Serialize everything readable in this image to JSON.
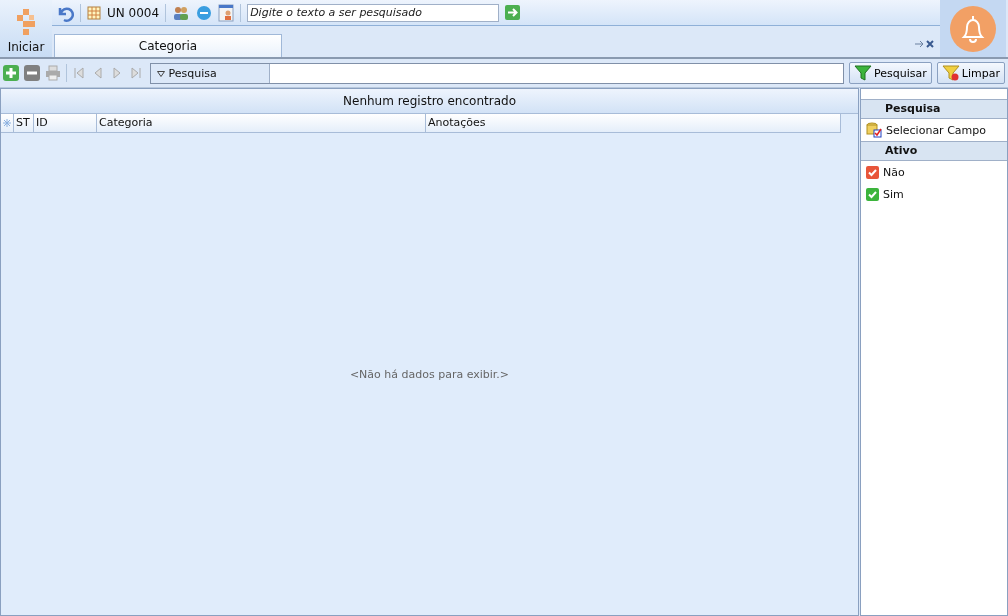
{
  "start_label": "Iniciar",
  "toolbar": {
    "unit": "UN 0004",
    "search": {
      "placeholder": "Digite o texto a ser pesquisado"
    }
  },
  "tabs": [
    {
      "label": "Categoria",
      "selected": true
    }
  ],
  "grid_toolbar": {
    "filter_label": "Pesquisa",
    "buttons": [
      "Pesquisar",
      "Limpar"
    ]
  },
  "grid": {
    "status": "Nenhum registro encontrado",
    "columns": [
      "ST",
      "ID",
      "Categoria",
      "Anotações"
    ],
    "empty_text": "<Não há dados para exibir.>"
  },
  "side_panel": {
    "sections": [
      {
        "title": "Pesquisa",
        "items": [
          {
            "label": "Selecionar Campo",
            "kind": "field"
          }
        ]
      },
      {
        "title": "Ativo",
        "items": [
          {
            "label": "Não",
            "kind": "flag",
            "color": "#e8553a"
          },
          {
            "label": "Sim",
            "kind": "flag",
            "color": "#3cb43c"
          }
        ]
      }
    ]
  }
}
